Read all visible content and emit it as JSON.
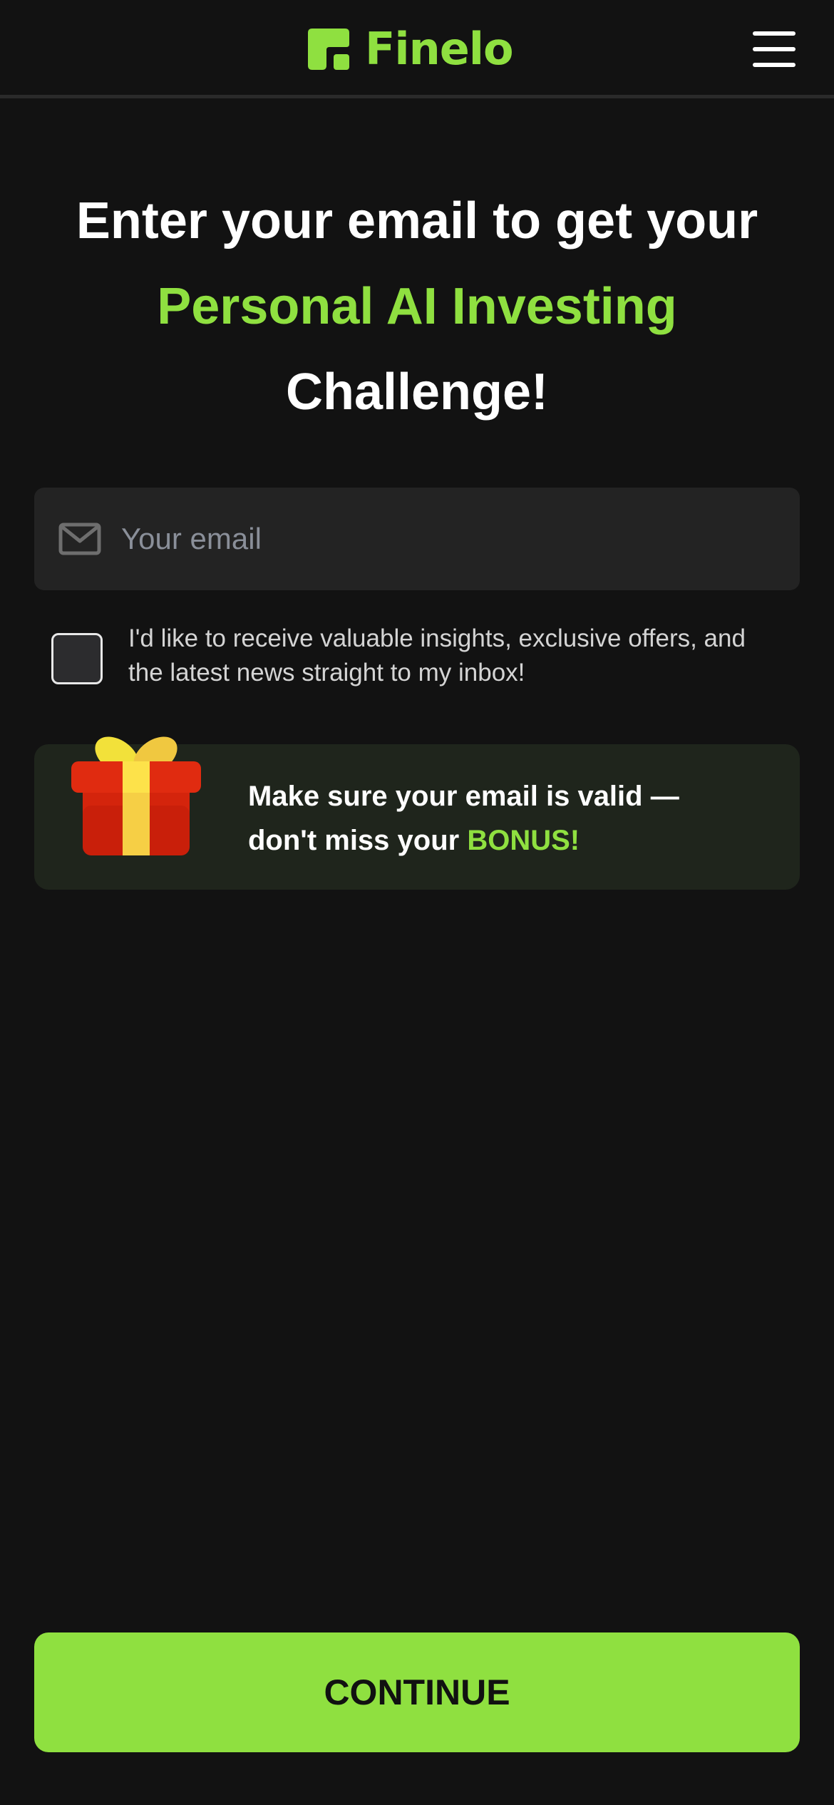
{
  "header": {
    "brand_name": "Finelo",
    "brand_color": "#8fe040",
    "logo_icon": "finelo-logo-icon",
    "menu_icon": "hamburger-menu-icon"
  },
  "headline": {
    "line1": "Enter your email to get your",
    "line2_accent": "Personal AI Investing",
    "line3": "Challenge!"
  },
  "email_field": {
    "icon": "mail-icon",
    "placeholder": "Your email",
    "value": ""
  },
  "consent": {
    "checked": false,
    "text": "I'd like to receive valuable insights, exclusive offers, and the latest news straight to my inbox!"
  },
  "bonus_banner": {
    "icon": "gift-icon",
    "text_line1": "Make sure your email is valid —",
    "text_line2_prefix": "don't miss your ",
    "text_accent": "BONUS!"
  },
  "continue_button": {
    "label": "CONTINUE"
  }
}
